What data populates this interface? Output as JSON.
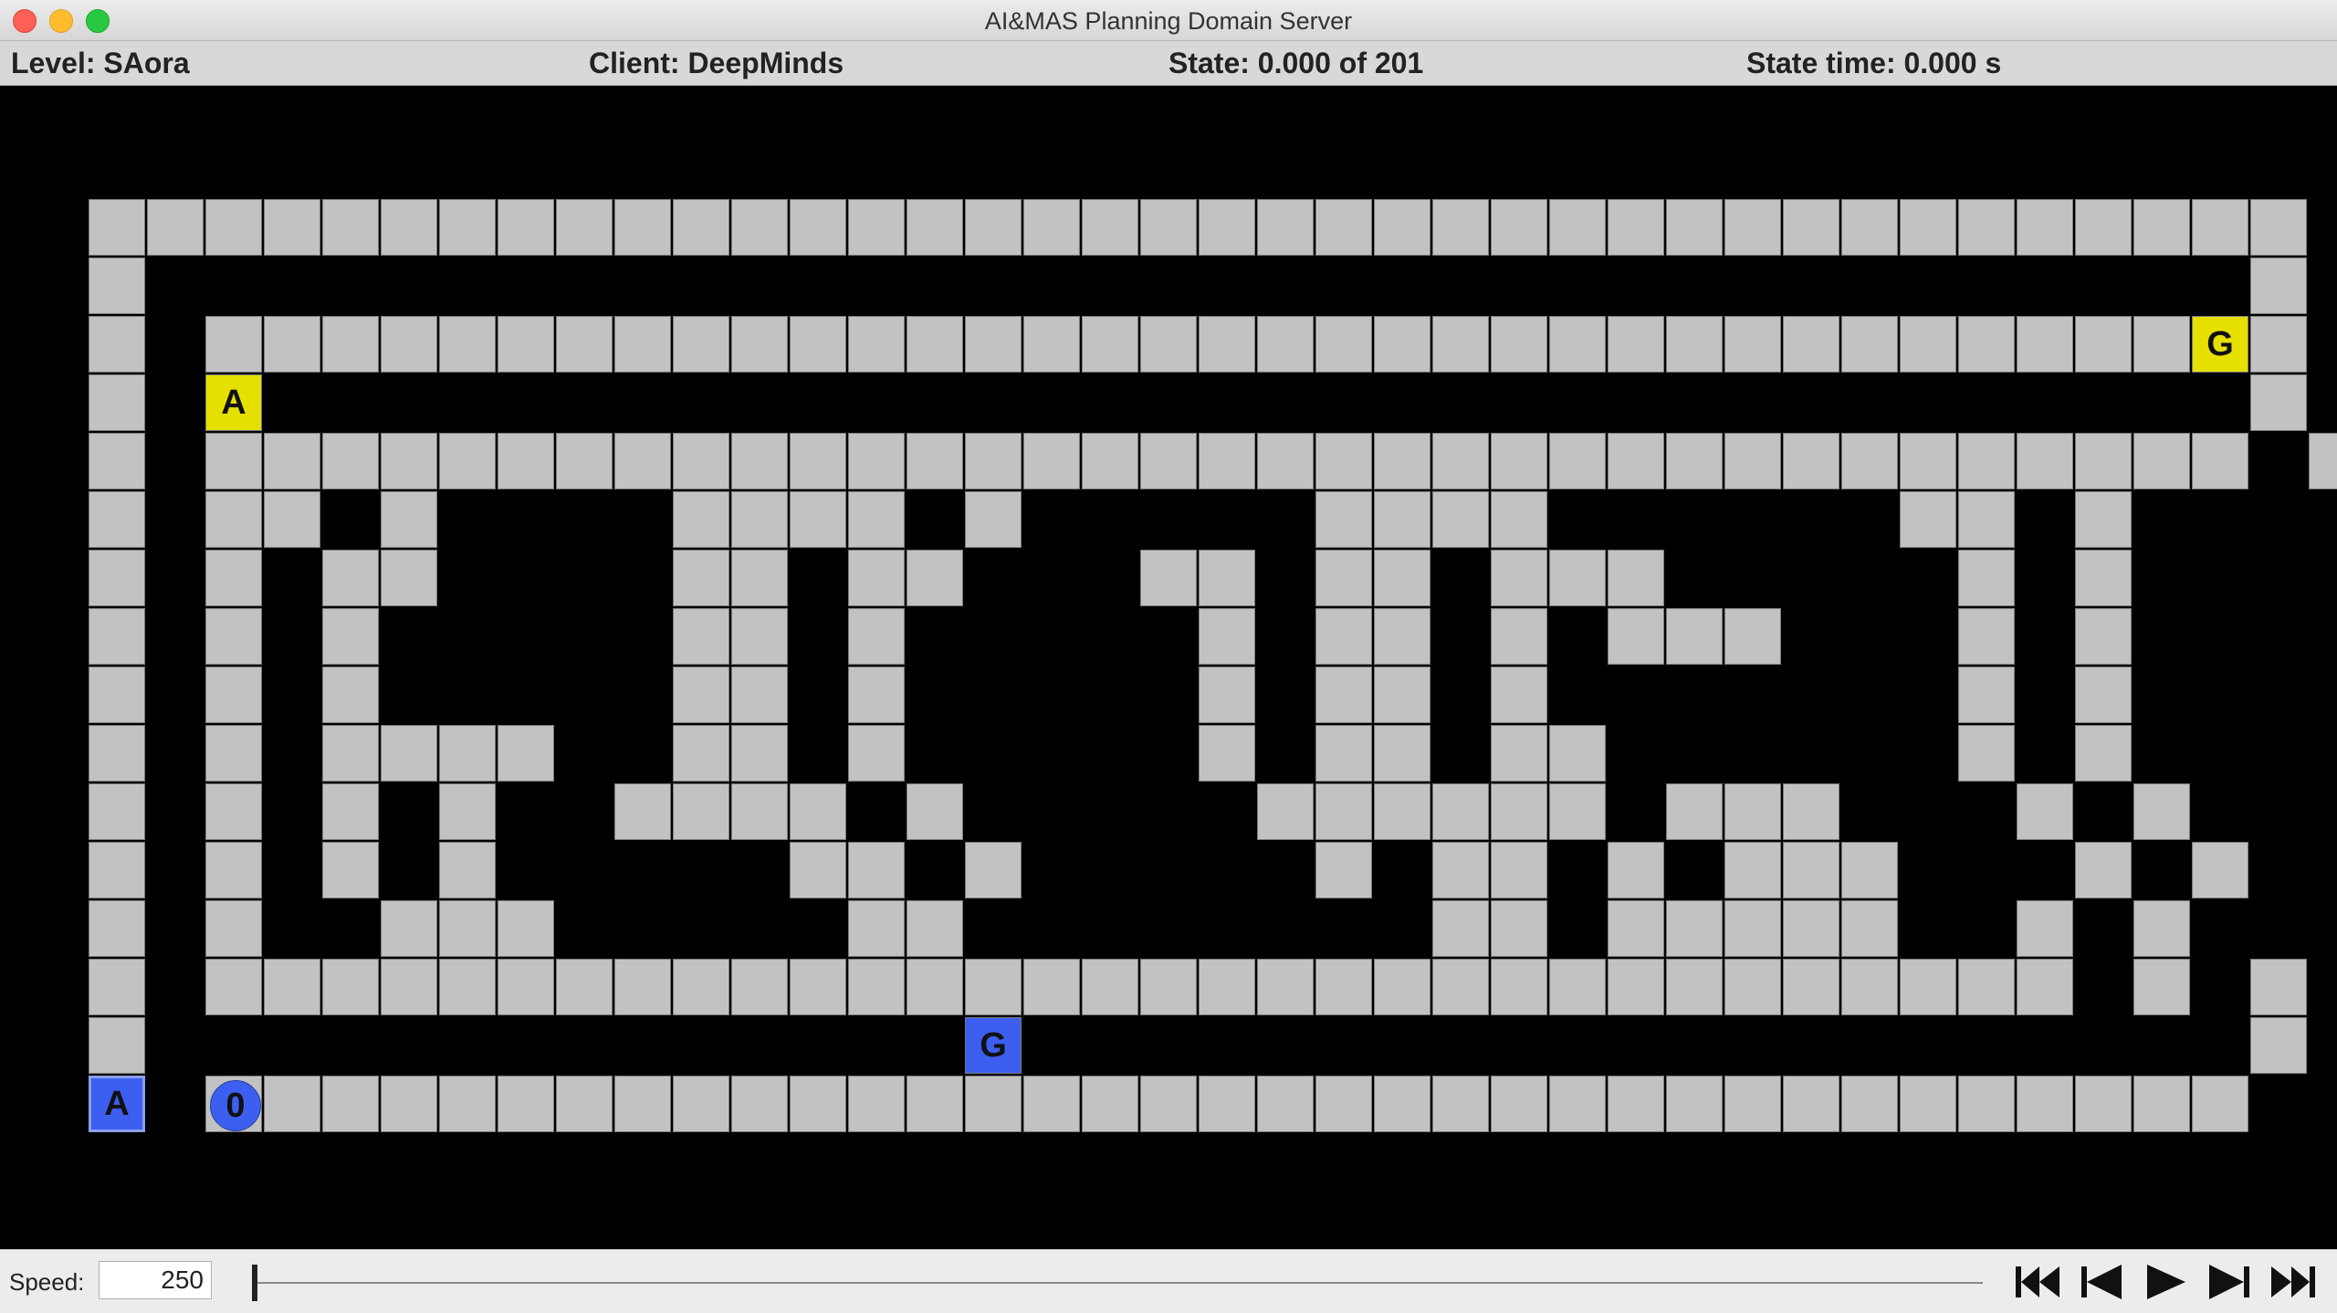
{
  "window": {
    "title": "AI&MAS Planning Domain Server"
  },
  "status": {
    "level": "Level: SAora",
    "client": "Client: DeepMinds",
    "state": "State: 0.000 of 201",
    "state_time": "State time: 0.000 s"
  },
  "controls": {
    "speed_label": "Speed:",
    "speed_value": "250",
    "progress": 0.0,
    "buttons": [
      "skip-to-start-icon",
      "step-back-icon",
      "play-icon",
      "step-forward-icon",
      "skip-to-end-icon"
    ]
  },
  "level_map": [
    "++++++++++++++++++++++++++++++++++++++",
    "+                                    +",
    "+ ++++++++++++++++++++++++++++++++++G+",
    "+ A                                  +",
    "+ +++++++++++++++++++++++++++++++++++ +",
    "+ ++ +    ++++ +     ++++      ++ +",
    "+ + ++    ++ ++   ++ ++ +++     + +",
    "+ + +     ++ +     + ++ + +++   + +",
    "+ + +     ++ +     + ++ +       + +",
    "+ + ++++  ++ +     + ++ ++      + +",
    "+ + + +  ++++ +     ++++++ +++   + +",
    "+ + + +     ++ +     + ++ + +++   + +",
    "+ +  +++     ++        ++ +++++  + +",
    "+ ++++++++++++++++++++++++++++++++ + +",
    "+               G                    +",
    "A 0++++++++++++++++++++++++++++++++++"
  ],
  "entities": [
    {
      "char": "G",
      "color": "yellow",
      "kind": "goal",
      "row": 2,
      "col": 36
    },
    {
      "char": "A",
      "color": "yellow",
      "kind": "box",
      "row": 3,
      "col": 2
    },
    {
      "char": "G",
      "color": "blue",
      "kind": "goal",
      "row": 14,
      "col": 15
    },
    {
      "char": "A",
      "color": "blue",
      "kind": "box",
      "row": 15,
      "col": 0
    },
    {
      "char": "0",
      "color": "blue",
      "kind": "agent",
      "row": 15,
      "col": 2
    }
  ],
  "colors": {
    "wall": "#c2c2c2",
    "background": "#000000",
    "yellow": "#e6e000",
    "blue": "#3c5ff0"
  }
}
